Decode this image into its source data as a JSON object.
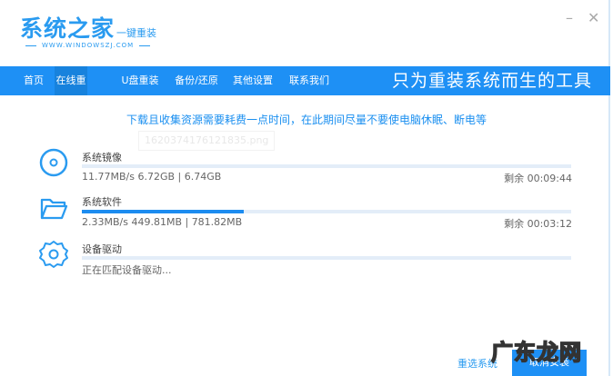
{
  "header": {
    "logo_main": "系统之家",
    "logo_sub": "一键重装",
    "logo_url": "WWW.WINDOWSZJ.COM",
    "minimize": "–",
    "close": "✕"
  },
  "nav": {
    "tabs": [
      {
        "label": "首页"
      },
      {
        "label": "在线重装",
        "active": true
      },
      {
        "label": "U盘重装"
      },
      {
        "label": "备份/还原"
      },
      {
        "label": "其他设置"
      },
      {
        "label": "联系我们"
      }
    ],
    "slogan": "只为重装系统而生的工具"
  },
  "notice": "下载且收集资源需要耗费一点时间，在此期间尽量不要使电脑休眠、断电等",
  "ghost_tooltip": "1620374176121835.png",
  "items": [
    {
      "title": "系统镜像",
      "icon": "disc-icon",
      "progress": 0,
      "speed": "11.77MB/s 6.72GB | 6.74GB",
      "remaining": "剩余 00:09:44"
    },
    {
      "title": "系统软件",
      "icon": "folder-icon",
      "progress": 0.33,
      "speed": "2.33MB/s 449.81MB | 781.82MB",
      "remaining": "剩余 00:03:12"
    },
    {
      "title": "设备驱动",
      "icon": "gear-icon",
      "progress": 0,
      "speed": "正在匹配设备驱动...",
      "remaining": ""
    }
  ],
  "buttons": {
    "reselect": "重选系统",
    "cancel": "取消安装"
  },
  "watermark": "广东龙网"
}
